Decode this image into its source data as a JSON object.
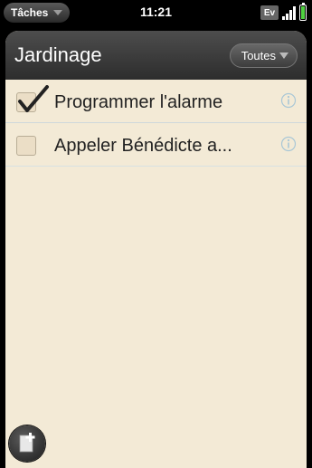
{
  "status_bar": {
    "app_menu_label": "Tâches",
    "time": "11:21",
    "network_label": "Ev"
  },
  "header": {
    "title": "Jardinage",
    "filter_label": "Toutes"
  },
  "tasks": [
    {
      "label": "Programmer l'alarme",
      "checked": true
    },
    {
      "label": "Appeler Bénédicte a...",
      "checked": false
    }
  ]
}
